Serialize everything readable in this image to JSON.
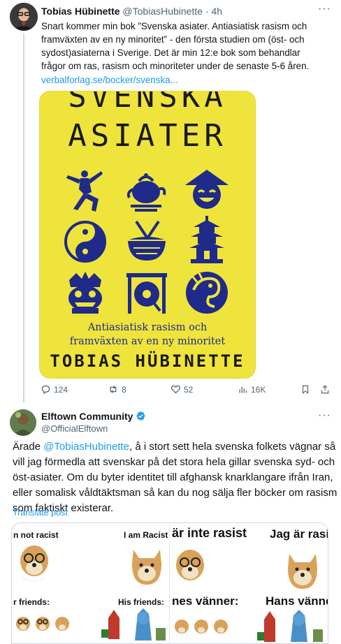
{
  "tweet1": {
    "name": "Tobias Hübinette",
    "handle": "@TobiasHubinette",
    "separator": "·",
    "time": "4h",
    "more_label": "···",
    "text": "Snart kommer min bok ”Svenska asiater. Antiasiatisk rasism och framväxten av en ny minoritet” - den första studien om (öst- och sydost)asiaterna i Sverige. Det är min 12:e bok som behandlar frågor om ras, rasism och minoriteter under de senaste 5-6 åren.",
    "link": "verbalforlag.se/bocker/svenska...",
    "book": {
      "title_line1": "SVENSKA",
      "title_line2": "ASIATER",
      "subtitle_line1": "Antiasiatisk rasism och",
      "subtitle_line2": "framväxten av en ny minoritet",
      "author": "TOBIAS HÜBINETTE",
      "icons": [
        "kungfu-figure-icon",
        "teapot-icon",
        "smiling-face-hat-icon",
        "yin-yang-icon",
        "noodle-bowl-icon",
        "pagoda-icon",
        "lion-dance-head-icon",
        "gong-icon",
        "dragon-icon"
      ],
      "colors": {
        "background": "#efe43c",
        "ink": "#1f2a8a"
      }
    },
    "actions": {
      "replies": "124",
      "reposts": "8",
      "likes": "52",
      "views": "16K"
    }
  },
  "tweet2": {
    "name": "Elftown Community",
    "verified_icon": "verified-badge-icon",
    "handle": "@OfficialElftown",
    "more_label": "···",
    "text_pre": "Ärade ",
    "mention": "@TobiasHubinette",
    "text_post": ", å i stort sett hela svenska folkets vägnar så vill jag förmedla att svenskar på det stora hela gillar svenska syd- och öst-asiater. Om du byter identitet till afghansk knarklangare ifrån Iran, eller somalisk våldtäktsman så kan du nog sälja fler böcker om rasism som faktiskt existerar.",
    "translate": "Translate post",
    "meme_left": {
      "top_left": "n not racist",
      "top_right": "I am Racist",
      "bottom_left": "r friends:",
      "bottom_right": "His friends:"
    },
    "meme_right": {
      "top_left": "är inte rasist",
      "top_right": "Jag är rasi",
      "bottom_left": "nes vänner:",
      "bottom_right": "Hans vänne"
    }
  },
  "colors": {
    "accent": "#1d9bf0",
    "muted": "#536471",
    "line": "#cfd9de"
  }
}
